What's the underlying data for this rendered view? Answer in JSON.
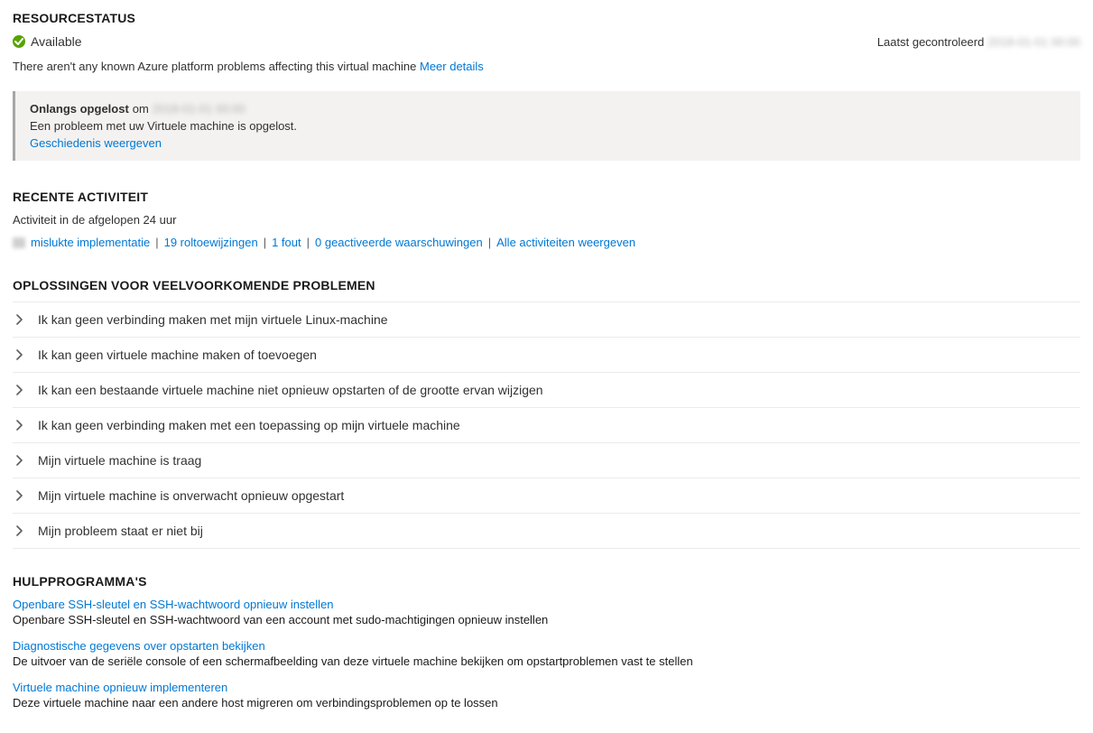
{
  "resourceStatus": {
    "heading": "RESOURCESTATUS",
    "availableLabel": "Available",
    "lastCheckedLabel": "Laatst gecontroleerd",
    "lastCheckedTime": "2018-01-01 00:00",
    "platformMessage": "There aren't any known Azure platform problems affecting this virtual machine",
    "moreDetails": "Meer details"
  },
  "resolved": {
    "titleBold": "Onlangs opgelost",
    "titleOm": "om",
    "timestamp": "2018-01-01 00:00",
    "description": "Een probleem met uw Virtuele machine is opgelost.",
    "historyLink": "Geschiedenis weergeven"
  },
  "recentActivity": {
    "heading": "RECENTE ACTIVITEIT",
    "subtitle": "Activiteit in de afgelopen 24 uur",
    "links": [
      {
        "text": "mislukte implementatie"
      },
      {
        "text": "19 roltoewijzingen"
      },
      {
        "text": "1 fout"
      },
      {
        "text": "0 geactiveerde waarschuwingen"
      },
      {
        "text": "Alle activiteiten weergeven"
      }
    ]
  },
  "solutions": {
    "heading": "OPLOSSINGEN VOOR VEELVOORKOMENDE PROBLEMEN",
    "items": [
      "Ik kan geen verbinding maken met mijn virtuele Linux-machine",
      "Ik kan geen virtuele machine maken of toevoegen",
      "Ik kan een bestaande virtuele machine niet opnieuw opstarten of de grootte ervan wijzigen",
      "Ik kan geen verbinding maken met een toepassing op mijn virtuele machine",
      "Mijn virtuele machine is traag",
      "Mijn virtuele machine is onverwacht opnieuw opgestart",
      "Mijn probleem staat er niet bij"
    ]
  },
  "tools": {
    "heading": "HULPPROGRAMMA'S",
    "items": [
      {
        "title": "Openbare SSH-sleutel en SSH-wachtwoord opnieuw instellen",
        "desc": "Openbare SSH-sleutel en SSH-wachtwoord van een account met sudo-machtigingen opnieuw instellen"
      },
      {
        "title": "Diagnostische gegevens over opstarten bekijken",
        "desc": "De uitvoer van de seriële console of een schermafbeelding van deze virtuele machine bekijken om opstartproblemen vast te stellen"
      },
      {
        "title": "Virtuele machine opnieuw implementeren",
        "desc": "Deze virtuele machine naar een andere host migreren om verbindingsproblemen op te lossen"
      }
    ]
  }
}
